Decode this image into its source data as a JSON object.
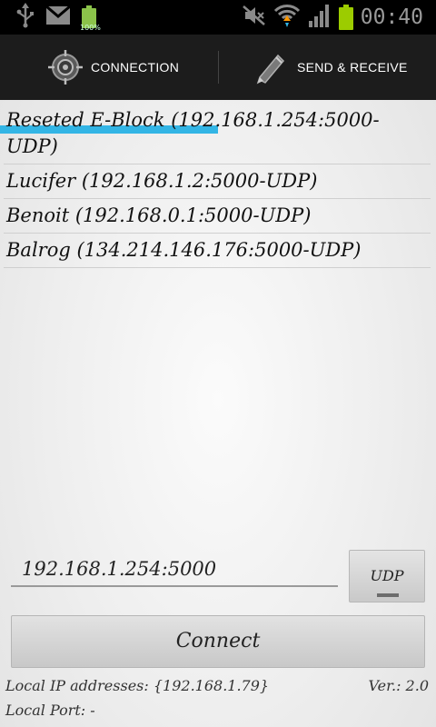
{
  "status_bar": {
    "battery_left_percent": "100%",
    "time": "00:40",
    "icons": [
      "usb-icon",
      "gmail-icon",
      "battery-full-icon",
      "mute-icon",
      "wifi-icon",
      "signal-icon",
      "battery-icon"
    ]
  },
  "tabs": [
    {
      "label": "CONNECTION",
      "icon": "target-icon",
      "selected": true
    },
    {
      "label": "SEND & RECEIVE",
      "icon": "pencil-icon",
      "selected": false
    }
  ],
  "colors": {
    "accent": "#33b5e5",
    "tabbar": "#1c1c1c",
    "statusbar": "#000000"
  },
  "devices": [
    "Reseted E-Block (192.168.1.254:5000-UDP)",
    "Lucifer (192.168.1.2:5000-UDP)",
    "Benoit (192.168.0.1:5000-UDP)",
    "Balrog (134.214.146.176:5000-UDP)"
  ],
  "address_input": {
    "value": "192.168.1.254:5000"
  },
  "protocol_button": {
    "label": "UDP"
  },
  "connect_button": {
    "label": "Connect"
  },
  "footer": {
    "local_ip": "Local IP addresses: {192.168.1.79}",
    "local_port": "Local Port: -",
    "version": "Ver.: 2.0"
  }
}
